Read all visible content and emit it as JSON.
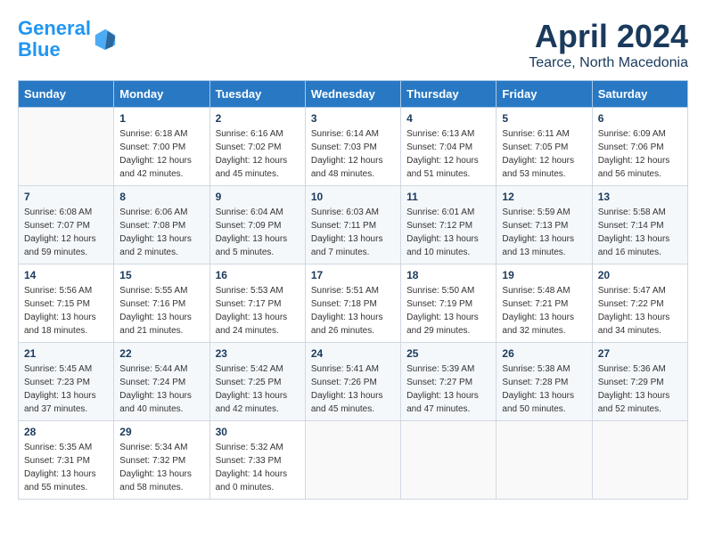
{
  "logo": {
    "line1": "General",
    "line2": "Blue"
  },
  "title": "April 2024",
  "subtitle": "Tearce, North Macedonia",
  "weekdays": [
    "Sunday",
    "Monday",
    "Tuesday",
    "Wednesday",
    "Thursday",
    "Friday",
    "Saturday"
  ],
  "weeks": [
    [
      {
        "day": "",
        "info": ""
      },
      {
        "day": "1",
        "info": "Sunrise: 6:18 AM\nSunset: 7:00 PM\nDaylight: 12 hours\nand 42 minutes."
      },
      {
        "day": "2",
        "info": "Sunrise: 6:16 AM\nSunset: 7:02 PM\nDaylight: 12 hours\nand 45 minutes."
      },
      {
        "day": "3",
        "info": "Sunrise: 6:14 AM\nSunset: 7:03 PM\nDaylight: 12 hours\nand 48 minutes."
      },
      {
        "day": "4",
        "info": "Sunrise: 6:13 AM\nSunset: 7:04 PM\nDaylight: 12 hours\nand 51 minutes."
      },
      {
        "day": "5",
        "info": "Sunrise: 6:11 AM\nSunset: 7:05 PM\nDaylight: 12 hours\nand 53 minutes."
      },
      {
        "day": "6",
        "info": "Sunrise: 6:09 AM\nSunset: 7:06 PM\nDaylight: 12 hours\nand 56 minutes."
      }
    ],
    [
      {
        "day": "7",
        "info": "Sunrise: 6:08 AM\nSunset: 7:07 PM\nDaylight: 12 hours\nand 59 minutes."
      },
      {
        "day": "8",
        "info": "Sunrise: 6:06 AM\nSunset: 7:08 PM\nDaylight: 13 hours\nand 2 minutes."
      },
      {
        "day": "9",
        "info": "Sunrise: 6:04 AM\nSunset: 7:09 PM\nDaylight: 13 hours\nand 5 minutes."
      },
      {
        "day": "10",
        "info": "Sunrise: 6:03 AM\nSunset: 7:11 PM\nDaylight: 13 hours\nand 7 minutes."
      },
      {
        "day": "11",
        "info": "Sunrise: 6:01 AM\nSunset: 7:12 PM\nDaylight: 13 hours\nand 10 minutes."
      },
      {
        "day": "12",
        "info": "Sunrise: 5:59 AM\nSunset: 7:13 PM\nDaylight: 13 hours\nand 13 minutes."
      },
      {
        "day": "13",
        "info": "Sunrise: 5:58 AM\nSunset: 7:14 PM\nDaylight: 13 hours\nand 16 minutes."
      }
    ],
    [
      {
        "day": "14",
        "info": "Sunrise: 5:56 AM\nSunset: 7:15 PM\nDaylight: 13 hours\nand 18 minutes."
      },
      {
        "day": "15",
        "info": "Sunrise: 5:55 AM\nSunset: 7:16 PM\nDaylight: 13 hours\nand 21 minutes."
      },
      {
        "day": "16",
        "info": "Sunrise: 5:53 AM\nSunset: 7:17 PM\nDaylight: 13 hours\nand 24 minutes."
      },
      {
        "day": "17",
        "info": "Sunrise: 5:51 AM\nSunset: 7:18 PM\nDaylight: 13 hours\nand 26 minutes."
      },
      {
        "day": "18",
        "info": "Sunrise: 5:50 AM\nSunset: 7:19 PM\nDaylight: 13 hours\nand 29 minutes."
      },
      {
        "day": "19",
        "info": "Sunrise: 5:48 AM\nSunset: 7:21 PM\nDaylight: 13 hours\nand 32 minutes."
      },
      {
        "day": "20",
        "info": "Sunrise: 5:47 AM\nSunset: 7:22 PM\nDaylight: 13 hours\nand 34 minutes."
      }
    ],
    [
      {
        "day": "21",
        "info": "Sunrise: 5:45 AM\nSunset: 7:23 PM\nDaylight: 13 hours\nand 37 minutes."
      },
      {
        "day": "22",
        "info": "Sunrise: 5:44 AM\nSunset: 7:24 PM\nDaylight: 13 hours\nand 40 minutes."
      },
      {
        "day": "23",
        "info": "Sunrise: 5:42 AM\nSunset: 7:25 PM\nDaylight: 13 hours\nand 42 minutes."
      },
      {
        "day": "24",
        "info": "Sunrise: 5:41 AM\nSunset: 7:26 PM\nDaylight: 13 hours\nand 45 minutes."
      },
      {
        "day": "25",
        "info": "Sunrise: 5:39 AM\nSunset: 7:27 PM\nDaylight: 13 hours\nand 47 minutes."
      },
      {
        "day": "26",
        "info": "Sunrise: 5:38 AM\nSunset: 7:28 PM\nDaylight: 13 hours\nand 50 minutes."
      },
      {
        "day": "27",
        "info": "Sunrise: 5:36 AM\nSunset: 7:29 PM\nDaylight: 13 hours\nand 52 minutes."
      }
    ],
    [
      {
        "day": "28",
        "info": "Sunrise: 5:35 AM\nSunset: 7:31 PM\nDaylight: 13 hours\nand 55 minutes."
      },
      {
        "day": "29",
        "info": "Sunrise: 5:34 AM\nSunset: 7:32 PM\nDaylight: 13 hours\nand 58 minutes."
      },
      {
        "day": "30",
        "info": "Sunrise: 5:32 AM\nSunset: 7:33 PM\nDaylight: 14 hours\nand 0 minutes."
      },
      {
        "day": "",
        "info": ""
      },
      {
        "day": "",
        "info": ""
      },
      {
        "day": "",
        "info": ""
      },
      {
        "day": "",
        "info": ""
      }
    ]
  ]
}
